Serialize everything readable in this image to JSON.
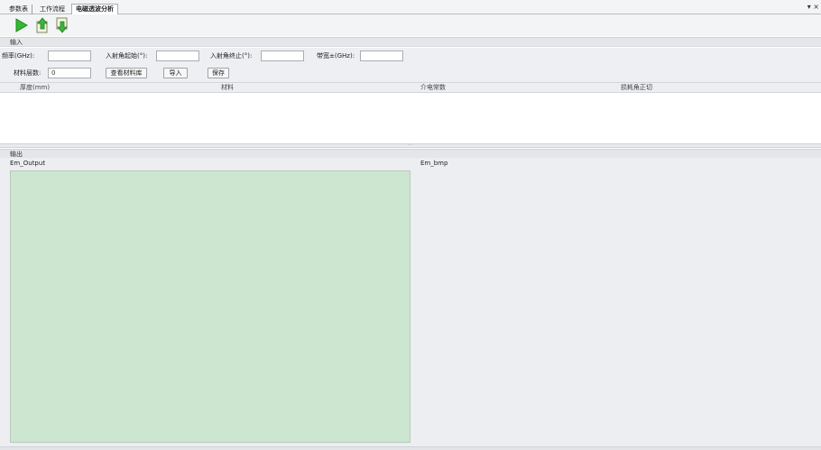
{
  "tabs": [
    {
      "label": "参数表"
    },
    {
      "label": "工作流程"
    },
    {
      "label": "电磁透波分析"
    }
  ],
  "tab_menu": "▾ ×",
  "toolbar": {
    "run_icon": "play-icon",
    "export_icon": "upload-icon",
    "import_icon": "download-icon",
    "accent_green": "#2fb52f"
  },
  "input_section": {
    "title": "输入",
    "freq_label": "频率(GHz):",
    "freq_value": "",
    "angle_start_label": "入射角起始(°):",
    "angle_start_value": "",
    "angle_end_label": "入射角终止(°):",
    "angle_end_value": "",
    "bandwidth_label": "带宽±(GHz):",
    "bandwidth_value": "",
    "layers_label": "材料层数:",
    "layers_value": "0",
    "view_library_button": "查看材料库",
    "import_button": "导入",
    "save_button": "保存"
  },
  "table": {
    "columns": [
      "厚度(mm)",
      "材料",
      "介电常数",
      "损耗角正切"
    ],
    "rows": []
  },
  "output_section": {
    "title": "输出",
    "left_label": "Em_Output",
    "right_label": "Em_bmp",
    "output_color": "#cde6cf"
  }
}
